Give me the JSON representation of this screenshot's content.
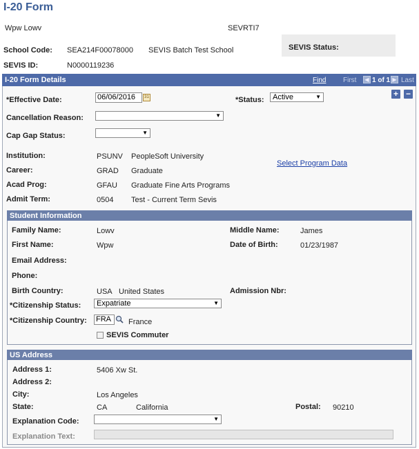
{
  "page": {
    "title": "I-20 Form",
    "student_name": "Wpw Lowv",
    "sevis_code": "SEVRTI7",
    "school_code_label": "School Code:",
    "school_code": "SEA214F00078000",
    "school_name": "SEVIS Batch Test School",
    "sevis_id_label": "SEVIS ID:",
    "sevis_id": "N0000119236",
    "sevis_status_label": "SEVIS Status:"
  },
  "form_details": {
    "header": "I-20 Form Details",
    "find_label": "Find",
    "first_label": "First",
    "count_label": "1 of 1",
    "last_label": "Last",
    "effective_date_label": "*Effective Date:",
    "effective_date": "06/06/2016",
    "status_label": "*Status:",
    "status_value": "Active",
    "cancellation_reason_label": "Cancellation Reason:",
    "cancellation_reason_value": "",
    "cap_gap_label": "Cap Gap Status:",
    "cap_gap_value": "",
    "institution_label": "Institution:",
    "institution_code": "PSUNV",
    "institution_name": "PeopleSoft University",
    "career_label": "Career:",
    "career_code": "GRAD",
    "career_name": "Graduate",
    "acad_prog_label": "Acad Prog:",
    "acad_prog_code": "GFAU",
    "acad_prog_name": "Graduate Fine Arts Programs",
    "admit_term_label": "Admit Term:",
    "admit_term_code": "0504",
    "admit_term_name": "Test - Current Term Sevis",
    "select_program_link": "Select Program Data"
  },
  "student_info": {
    "header": "Student Information",
    "family_name_label": "Family Name:",
    "family_name": "Lowv",
    "middle_name_label": "Middle Name:",
    "middle_name": "James",
    "first_name_label": "First Name:",
    "first_name": "Wpw",
    "dob_label": "Date of Birth:",
    "dob": "01/23/1987",
    "email_label": "Email Address:",
    "phone_label": "Phone:",
    "birth_country_label": "Birth Country:",
    "birth_country_code": "USA",
    "birth_country_name": "United States",
    "admission_nbr_label": "Admission Nbr:",
    "citizenship_status_label": "*Citizenship Status:",
    "citizenship_status_value": "Expatriate",
    "citizenship_country_label": "*Citizenship Country:",
    "citizenship_country_code": "FRA",
    "citizenship_country_name": "France",
    "sevis_commuter_label": "SEVIS Commuter"
  },
  "us_address": {
    "header": "US Address",
    "address1_label": "Address 1:",
    "address1": "5406 Xw St.",
    "address2_label": "Address 2:",
    "city_label": "City:",
    "city": "Los Angeles",
    "state_label": "State:",
    "state_code": "CA",
    "state_name": "California",
    "postal_label": "Postal:",
    "postal": "90210",
    "explanation_code_label": "Explanation Code:",
    "explanation_code_value": "",
    "explanation_text_label": "Explanation Text:"
  },
  "icons": {
    "calendar": "calendar-icon",
    "lookup": "magnifier-icon",
    "add": "plus-icon",
    "remove": "minus-icon"
  },
  "colors": {
    "title": "#3a5d96",
    "header_bar": "#4e6aa8",
    "subheader_bar": "#6b7fa9",
    "link": "#1a3ea6"
  }
}
